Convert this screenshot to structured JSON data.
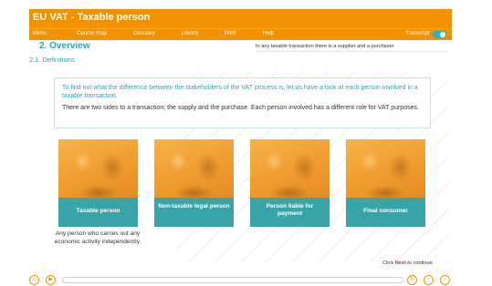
{
  "app": {
    "title": "EU VAT - Taxable person"
  },
  "menu": {
    "items": [
      "Menu",
      "Course map",
      "Glossary",
      "Library",
      "Print",
      "Help"
    ],
    "transcript_label": "Transcript",
    "transcript_on": true
  },
  "header": {
    "section_title": "2. Overview",
    "subsection": "2.1. Definitions",
    "note": "In any taxable transaction there is a supplier and a purchaser."
  },
  "intro": {
    "lead": "To find out what the difference between the stakeholders of the VAT process is, let us have a look at each person involved in a taxable transaction.",
    "body": "There are two sides to a transaction; the supply and the purchase. Each person involved has a different role for VAT purposes."
  },
  "cards": [
    {
      "label": "Taxable person",
      "icon": "people-photo",
      "description": "Any person who carries out any economic activity independently."
    },
    {
      "label": "Non-taxable legal person",
      "icon": "people-photo"
    },
    {
      "label": "Person liable for payment",
      "icon": "people-photo"
    },
    {
      "label": "Final consumer",
      "icon": "people-photo"
    }
  ],
  "footer": {
    "hint_prefix": "Click ",
    "hint_bold": "Next",
    "hint_suffix": " to continue."
  },
  "player": {
    "progress_fraction": 0.0,
    "icons": [
      "audio-icon",
      "play-icon",
      "replay-icon",
      "back-icon",
      "next-icon"
    ]
  },
  "colors": {
    "brand_orange": "#f39200",
    "accent_teal": "#2aa6b3"
  }
}
